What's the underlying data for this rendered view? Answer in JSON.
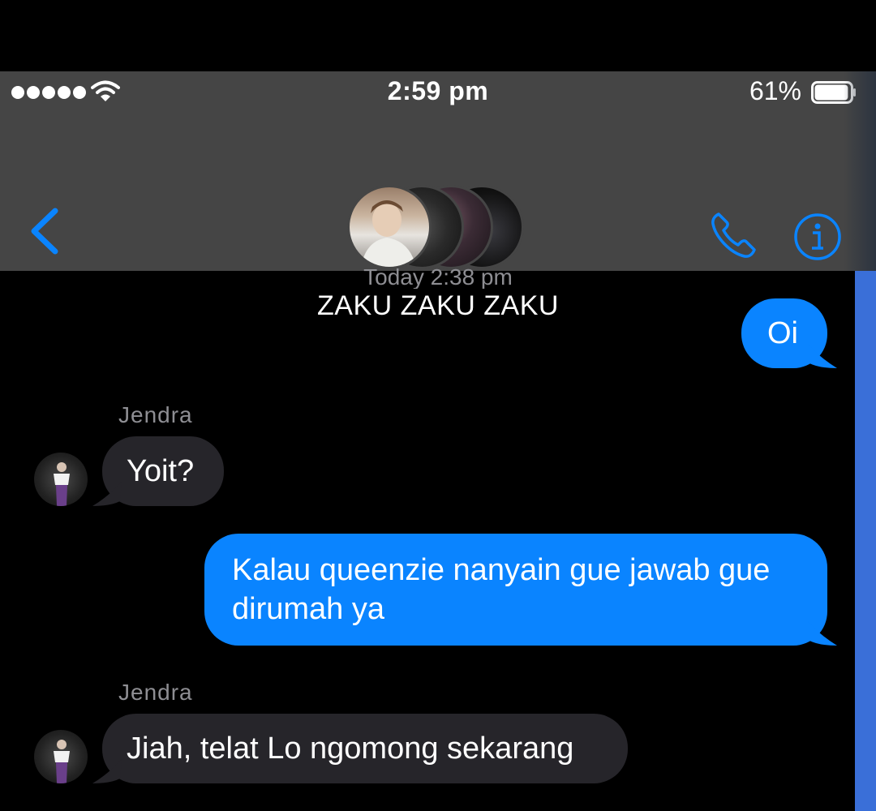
{
  "status_bar": {
    "time": "2:59 pm",
    "battery_percent": "61%",
    "battery_level": 0.95,
    "signal_bars": 5
  },
  "header": {
    "group_name": "ZAKU ZAKU ZAKU",
    "back_icon": "chevron-left-icon",
    "call_icon": "phone-icon",
    "info_icon": "info-icon"
  },
  "conversation": {
    "timestamp": "Today 2:38 pm",
    "messages": [
      {
        "direction": "outgoing",
        "text": "Oi"
      },
      {
        "direction": "incoming",
        "sender": "Jendra",
        "text": "Yoit?"
      },
      {
        "direction": "outgoing",
        "text": "Kalau queenzie nanyain gue jawab gue dirumah ya"
      },
      {
        "direction": "incoming",
        "sender": "Jendra",
        "text": "Jiah, telat Lo ngomong sekarang"
      }
    ]
  },
  "colors": {
    "accent": "#0a84ff",
    "header_bg": "#454545",
    "incoming_bubble": "#26252a",
    "background": "#000000"
  }
}
